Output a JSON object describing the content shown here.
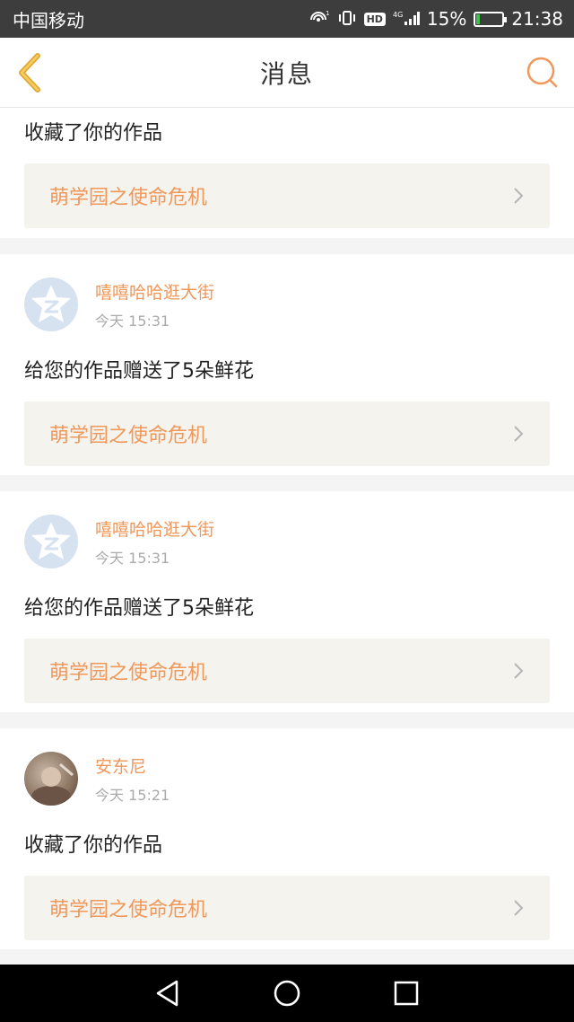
{
  "status_bar": {
    "carrier": "中国移动",
    "network_label": "4G",
    "hd_label": "HD",
    "battery_percent": "15%",
    "battery_level": 0.15,
    "time": "21:38"
  },
  "header": {
    "title": "消息",
    "back_icon": "chevron-left-icon",
    "search_icon": "search-icon",
    "accent_color": "#f0975a"
  },
  "messages": [
    {
      "action": "收藏了你的作品",
      "work_title": "萌学园之使命危机"
    },
    {
      "username": "嘻嘻哈哈逛大街",
      "time": "今天 15:31",
      "action": "给您的作品赠送了5朵鲜花",
      "work_title": "萌学园之使命危机",
      "avatar": "default-avatar-icon"
    },
    {
      "username": "嘻嘻哈哈逛大街",
      "time": "今天 15:31",
      "action": "给您的作品赠送了5朵鲜花",
      "work_title": "萌学园之使命危机",
      "avatar": "default-avatar-icon"
    },
    {
      "username": "安东尼",
      "time": "今天 15:21",
      "action": "收藏了你的作品",
      "work_title": "萌学园之使命危机",
      "avatar": "photo-avatar"
    }
  ],
  "nav_bar": {
    "back": "triangle-back-icon",
    "home": "circle-home-icon",
    "recents": "square-recents-icon"
  }
}
